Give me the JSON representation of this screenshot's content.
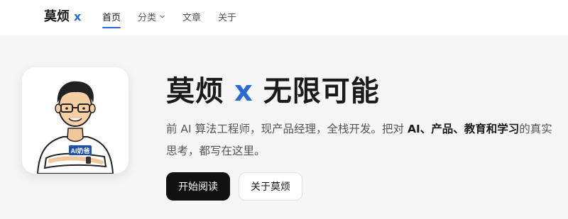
{
  "header": {
    "brand_name": "莫烦",
    "brand_x": "x",
    "nav": [
      {
        "label": "首页",
        "active": true
      },
      {
        "label": "分类",
        "has_dropdown": true
      },
      {
        "label": "文章"
      },
      {
        "label": "关于"
      }
    ]
  },
  "hero": {
    "title_prefix": "莫烦",
    "title_x": "x",
    "title_suffix": "无限可能",
    "desc_part1": "前 AI 算法工程师，现产品经理，全栈开发。把对 ",
    "desc_bold": "AI、产品、教育和学习",
    "desc_part2": "的真实思考，都写在这里。",
    "avatar_badge": "AI奶爸",
    "primary_button": "开始阅读",
    "secondary_button": "关于莫烦"
  },
  "colors": {
    "accent": "#2a6ad6",
    "primary_button_bg": "#111111"
  }
}
